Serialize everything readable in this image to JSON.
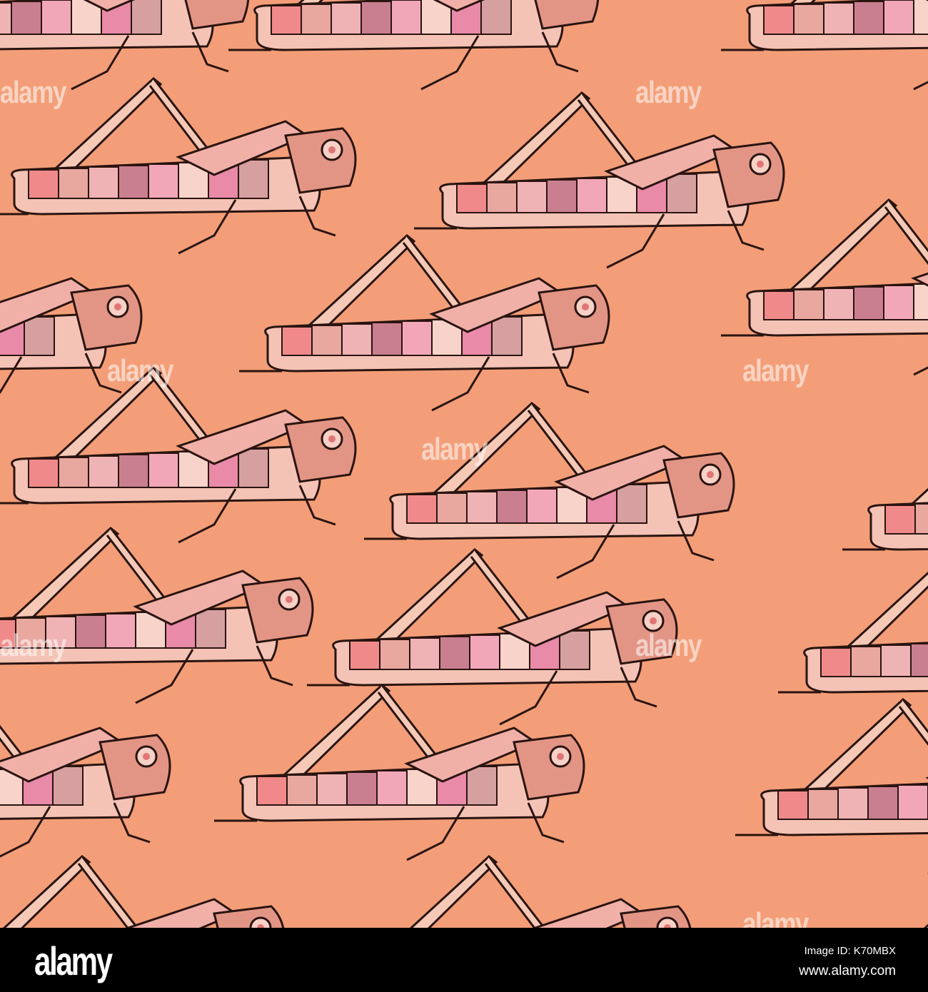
{
  "image": {
    "subject": "grasshopper-pattern",
    "background_color": "#f39e78",
    "watermark_text": "alamy"
  },
  "footer": {
    "logo": "alamy",
    "image_id": "Image ID: K70MBX",
    "url": "www.alamy.com"
  }
}
